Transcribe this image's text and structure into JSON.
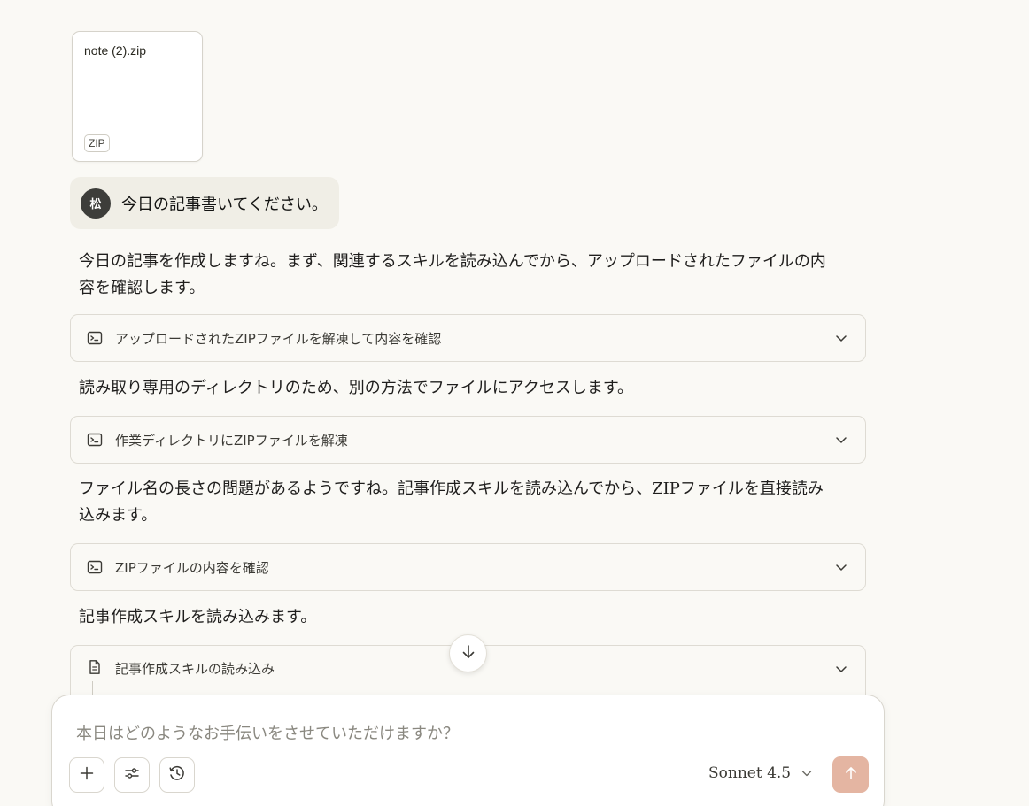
{
  "attachment": {
    "file_name": "note (2).zip",
    "file_type": "ZIP"
  },
  "user_message": {
    "avatar_initial": "松",
    "text": "今日の記事書いてください。"
  },
  "assistant": {
    "paragraphs": [
      "今日の記事を作成しますね。まず、関連するスキルを読み込んでから、アップロードされたファイルの内容を確認します。",
      "読み取り専用のディレクトリのため、別の方法でファイルにアクセスします。",
      "ファイル名の長さの問題があるようですね。記事作成スキルを読み込んでから、ZIPファイルを直接読み込みます。",
      "記事作成スキルを読み込みます。"
    ],
    "tool_calls": [
      {
        "label": "アップロードされたZIPファイルを解凍して内容を確認",
        "icon": "terminal-icon"
      },
      {
        "label": "作業ディレクトリにZIPファイルを解凍",
        "icon": "terminal-icon"
      },
      {
        "label": "ZIPファイルの内容を確認",
        "icon": "terminal-icon"
      },
      {
        "label": "記事作成スキルの読み込み",
        "icon": "document-icon"
      }
    ]
  },
  "composer": {
    "placeholder": "本日はどのようなお手伝いをさせていただけますか？",
    "model": "Sonnet 4.5"
  },
  "colors": {
    "background": "#faf9f5",
    "send_button": "#e4b5a2",
    "user_bubble": "#f0eee6"
  }
}
